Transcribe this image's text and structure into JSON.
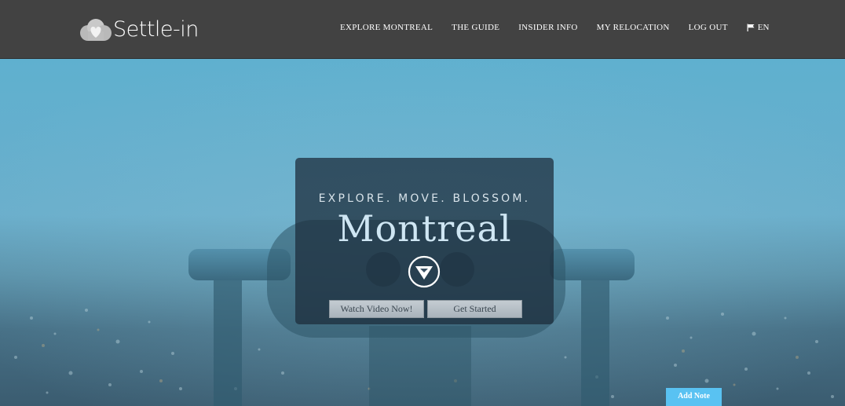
{
  "header": {
    "logo_text": "Settle-in",
    "nav": [
      {
        "label": "EXPLORE MONTREAL"
      },
      {
        "label": "THE GUIDE"
      },
      {
        "label": "INSIDER INFO"
      },
      {
        "label": "MY RELOCATION"
      },
      {
        "label": "LOG OUT"
      }
    ],
    "language": {
      "label": "EN",
      "icon": "flag-icon"
    }
  },
  "hero": {
    "tagline": "EXPLORE. MOVE. BLOSSOM.",
    "city": "Montreal",
    "arrow_icon": "down-arrow-icon",
    "buttons": {
      "watch_video": "Watch Video Now!",
      "get_started": "Get Started"
    }
  },
  "add_note": {
    "label": "Add Note"
  },
  "colors": {
    "header_bg": "#424242",
    "hero_sky": "#5fa6c4",
    "card_bg": "#1c2c3c",
    "add_note_bg": "#59c2f2"
  }
}
